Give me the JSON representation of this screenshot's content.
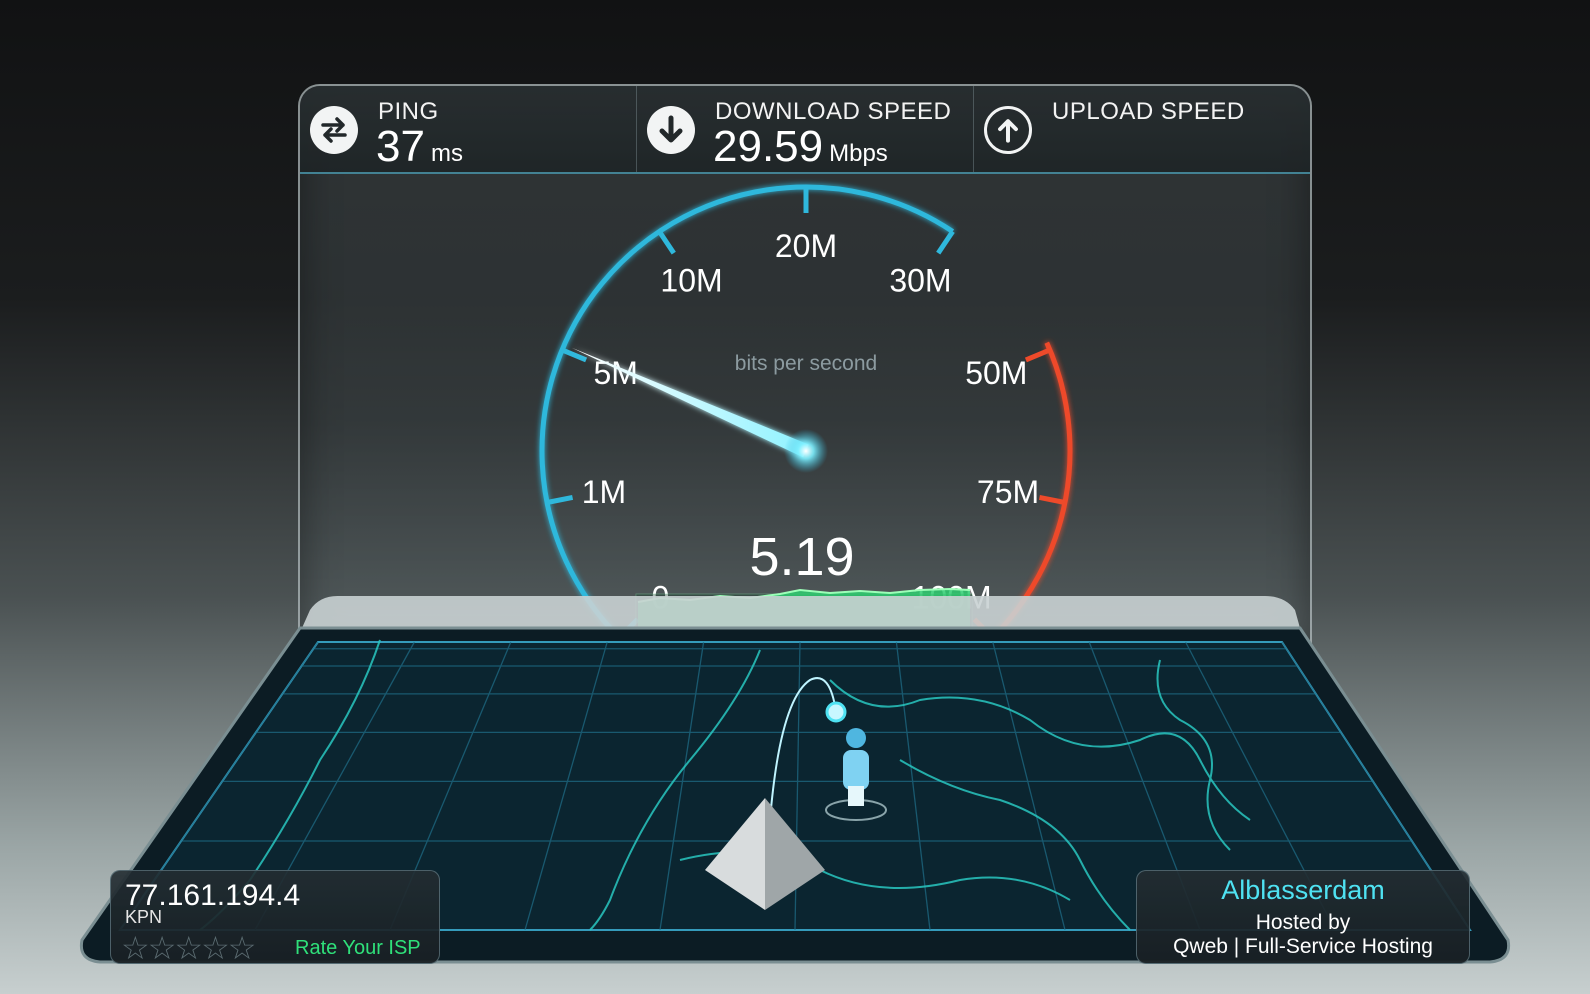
{
  "header": {
    "ping": {
      "label": "PING",
      "value": "37",
      "unit": "ms",
      "icon": "ping-arrows-icon"
    },
    "download": {
      "label": "DOWNLOAD SPEED",
      "value": "29.59",
      "unit": "Mbps",
      "icon": "download-arrow-icon"
    },
    "upload": {
      "label": "UPLOAD SPEED",
      "value": "",
      "unit": "",
      "icon": "upload-arrow-icon"
    }
  },
  "gauge": {
    "unit_label": "bits per second",
    "current_value": "5.19",
    "needle_value_mbps": 5.19,
    "ticks": [
      "0",
      "1M",
      "5M",
      "10M",
      "20M",
      "30M",
      "50M",
      "75M",
      "100M"
    ],
    "colors": {
      "normal": "#2fb8dc",
      "high": "#ee4a2a",
      "graph": "#2ecc71"
    }
  },
  "client": {
    "ip": "77.161.194.4",
    "isp": "KPN",
    "rating_stars": 5,
    "rate_label": "Rate Your ISP"
  },
  "server": {
    "city": "Alblasserdam",
    "hosted_by_label": "Hosted by",
    "host": "Qweb | Full-Service Hosting"
  }
}
